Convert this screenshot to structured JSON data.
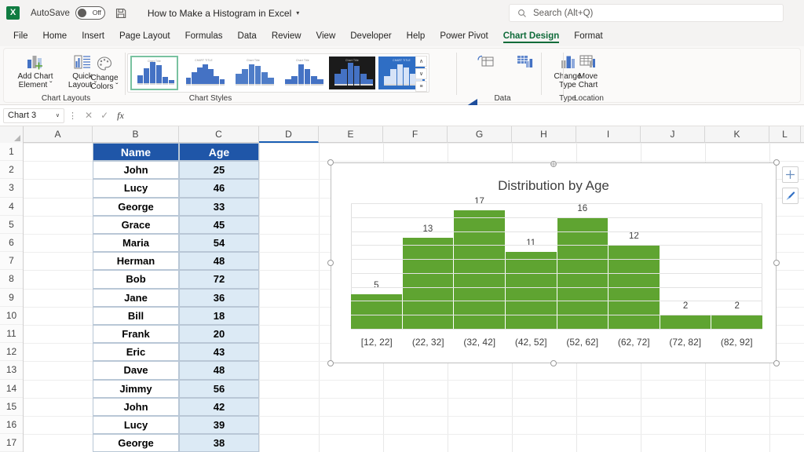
{
  "titlebar": {
    "app_icon": "excel-logo-icon",
    "autosave_label": "AutoSave",
    "autosave_state": "Off",
    "save_icon": "save-icon",
    "document_title": "How to Make a Histogram in Excel",
    "title_caret": "▾"
  },
  "search": {
    "icon": "search-icon",
    "placeholder": "Search (Alt+Q)"
  },
  "tabs": [
    {
      "label": "File",
      "active": false
    },
    {
      "label": "Home",
      "active": false
    },
    {
      "label": "Insert",
      "active": false
    },
    {
      "label": "Page Layout",
      "active": false
    },
    {
      "label": "Formulas",
      "active": false
    },
    {
      "label": "Data",
      "active": false
    },
    {
      "label": "Review",
      "active": false
    },
    {
      "label": "View",
      "active": false
    },
    {
      "label": "Developer",
      "active": false
    },
    {
      "label": "Help",
      "active": false
    },
    {
      "label": "Power Pivot",
      "active": false
    },
    {
      "label": "Chart Design",
      "active": true
    },
    {
      "label": "Format",
      "active": false
    }
  ],
  "ribbon": {
    "groups": [
      {
        "name": "Chart Layouts",
        "label": "Chart Layouts"
      },
      {
        "name": "Chart Styles",
        "label": "Chart Styles"
      },
      {
        "name": "Data",
        "label": "Data"
      },
      {
        "name": "Type",
        "label": "Type"
      },
      {
        "name": "Location",
        "label": "Location"
      }
    ],
    "add_chart_element": {
      "line1": "Add Chart",
      "line2": "Element",
      "caret": "ˇ"
    },
    "quick_layout": {
      "line1": "Quick",
      "line2": "Layout",
      "caret": "ˇ"
    },
    "change_colors": {
      "line1": "Change",
      "line2": "Colors",
      "caret": "ˇ"
    },
    "switch_row_column": {
      "line1": "",
      "line2": ""
    },
    "select_data": {
      "line1": "",
      "line2": ""
    },
    "change_chart_type": {
      "line1": "Change",
      "line2": "Type"
    },
    "move_chart": {
      "line1": "Move",
      "line2": "Chart"
    },
    "gallery_nav": {
      "up": "∧",
      "down": "∨",
      "more": "≡"
    },
    "styles": [
      {
        "title": "Chart Title",
        "selected": true,
        "theme": "light"
      },
      {
        "title": "CHART TITLE",
        "selected": false,
        "theme": "light"
      },
      {
        "title": "Chart Title",
        "selected": false,
        "theme": "grad"
      },
      {
        "title": "Chart Title",
        "selected": false,
        "theme": "light"
      },
      {
        "title": "Chart Title",
        "selected": false,
        "theme": "dark"
      },
      {
        "title": "CHART TITLE",
        "selected": false,
        "theme": "blue"
      }
    ]
  },
  "annotation": {
    "type": "left-arrow",
    "color": "#1F4E9C"
  },
  "formula_bar": {
    "name_box_value": "Chart 3",
    "name_box_caret": "∨",
    "cancel_icon": "close-icon",
    "confirm_icon": "check-icon",
    "fx_label": "fx",
    "formula_value": ""
  },
  "grid": {
    "columns": [
      "A",
      "B",
      "C",
      "D",
      "E",
      "F",
      "G",
      "H",
      "I",
      "J",
      "K",
      "L"
    ],
    "active_column": "D",
    "rows": [
      "1",
      "2",
      "3",
      "4",
      "5",
      "6",
      "7",
      "8",
      "9",
      "10",
      "11",
      "12",
      "13",
      "14",
      "15",
      "16",
      "17"
    ],
    "table_headers": {
      "name": "Name",
      "age": "Age"
    },
    "table_rows": [
      {
        "name": "John",
        "age": "25"
      },
      {
        "name": "Lucy",
        "age": "46"
      },
      {
        "name": "George",
        "age": "33"
      },
      {
        "name": "Grace",
        "age": "45"
      },
      {
        "name": "Maria",
        "age": "54"
      },
      {
        "name": "Herman",
        "age": "48"
      },
      {
        "name": "Bob",
        "age": "72"
      },
      {
        "name": "Jane",
        "age": "36"
      },
      {
        "name": "Bill",
        "age": "18"
      },
      {
        "name": "Frank",
        "age": "20"
      },
      {
        "name": "Eric",
        "age": "43"
      },
      {
        "name": "Dave",
        "age": "48"
      },
      {
        "name": "Jimmy",
        "age": "56"
      },
      {
        "name": "John",
        "age": "42"
      },
      {
        "name": "Lucy",
        "age": "39"
      },
      {
        "name": "George",
        "age": "38"
      }
    ],
    "header_fill": "#1F56A8",
    "age_fill": "#DCEAF5"
  },
  "chart_object": {
    "selected": true,
    "buttons": [
      {
        "name": "chart-elements-button",
        "glyph": "+"
      },
      {
        "name": "chart-styles-button",
        "glyph": "brush"
      }
    ]
  },
  "chart_data": {
    "type": "bar",
    "title": "Distribution by Age",
    "xlabel": "",
    "ylabel": "",
    "categories": [
      "[12, 22]",
      "(22, 32]",
      "(32, 42]",
      "(42, 52]",
      "(52, 62]",
      "(62, 72]",
      "(72, 82]",
      "(82, 92]"
    ],
    "values": [
      5,
      13,
      17,
      11,
      16,
      12,
      2,
      2
    ],
    "data_labels": [
      "5",
      "13",
      "17",
      "11",
      "16",
      "12",
      "2",
      "2"
    ],
    "ylim": [
      0,
      18
    ],
    "grid": true,
    "gridline_count": 9,
    "legend": "none",
    "bar_color": "#5FA431",
    "label_color": "#404040"
  }
}
